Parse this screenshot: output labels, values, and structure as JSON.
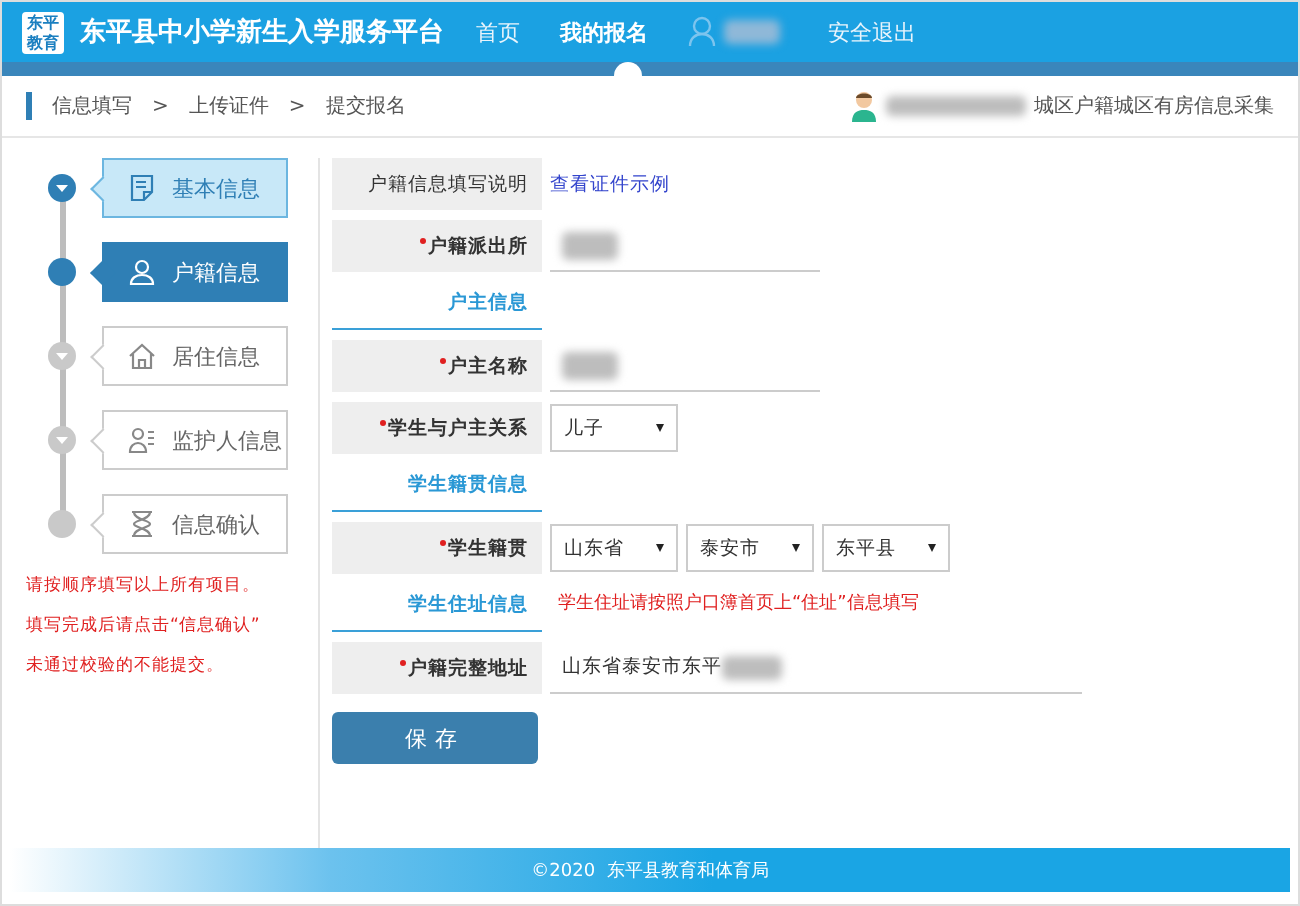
{
  "header": {
    "logo": "东平教育",
    "title": "东平县中小学新生入学服务平台",
    "nav": [
      {
        "label": "首页",
        "selected": false,
        "kind": "link"
      },
      {
        "label": "我的报名",
        "selected": true,
        "kind": "link"
      },
      {
        "kind": "user",
        "redacted": true
      },
      {
        "label": "安全退出",
        "selected": false,
        "kind": "link"
      }
    ]
  },
  "breadcrumb": {
    "items": [
      "信息填写",
      ">",
      "上传证件",
      ">",
      "提交报名"
    ],
    "user_redacted": true,
    "category": "城区户籍城区有房信息采集"
  },
  "steps": [
    {
      "label": "基本信息",
      "selected": false,
      "completed": true
    },
    {
      "label": "户籍信息",
      "selected": true,
      "completed": false
    },
    {
      "label": "居住信息",
      "selected": false,
      "completed": false
    },
    {
      "label": "监护人信息",
      "selected": false,
      "completed": false
    },
    {
      "label": "信息确认",
      "selected": false,
      "completed": false
    }
  ],
  "notes": [
    "请按顺序填写以上所有项目。",
    "填写完成后请点击“信息确认”",
    "未通过校验的不能提交。"
  ],
  "form": [
    {
      "kind": "link",
      "label": "户籍信息填写说明",
      "required": false,
      "link": "查看证件示例"
    },
    {
      "kind": "input",
      "label": "户籍派出所",
      "required": true,
      "redacted": true
    },
    {
      "kind": "section",
      "label": "户主信息"
    },
    {
      "kind": "input",
      "label": "户主名称",
      "required": true,
      "redacted": true
    },
    {
      "kind": "select",
      "label": "学生与户主关系",
      "required": true,
      "options": [
        "儿子"
      ]
    },
    {
      "kind": "section",
      "label": "学生籍贯信息"
    },
    {
      "kind": "select",
      "label": "学生籍贯",
      "required": true,
      "options": [
        "山东省",
        "泰安市",
        "东平县"
      ]
    },
    {
      "kind": "section",
      "label": "学生住址信息",
      "note": "学生住址请按照户口簿首页上“住址”信息填写"
    },
    {
      "kind": "address",
      "label": "户籍完整地址",
      "required": true,
      "value": "山东省泰安市东平",
      "redacted": true
    }
  ],
  "save_button": "保存",
  "footer": "©2020  东平县教育和体育局"
}
